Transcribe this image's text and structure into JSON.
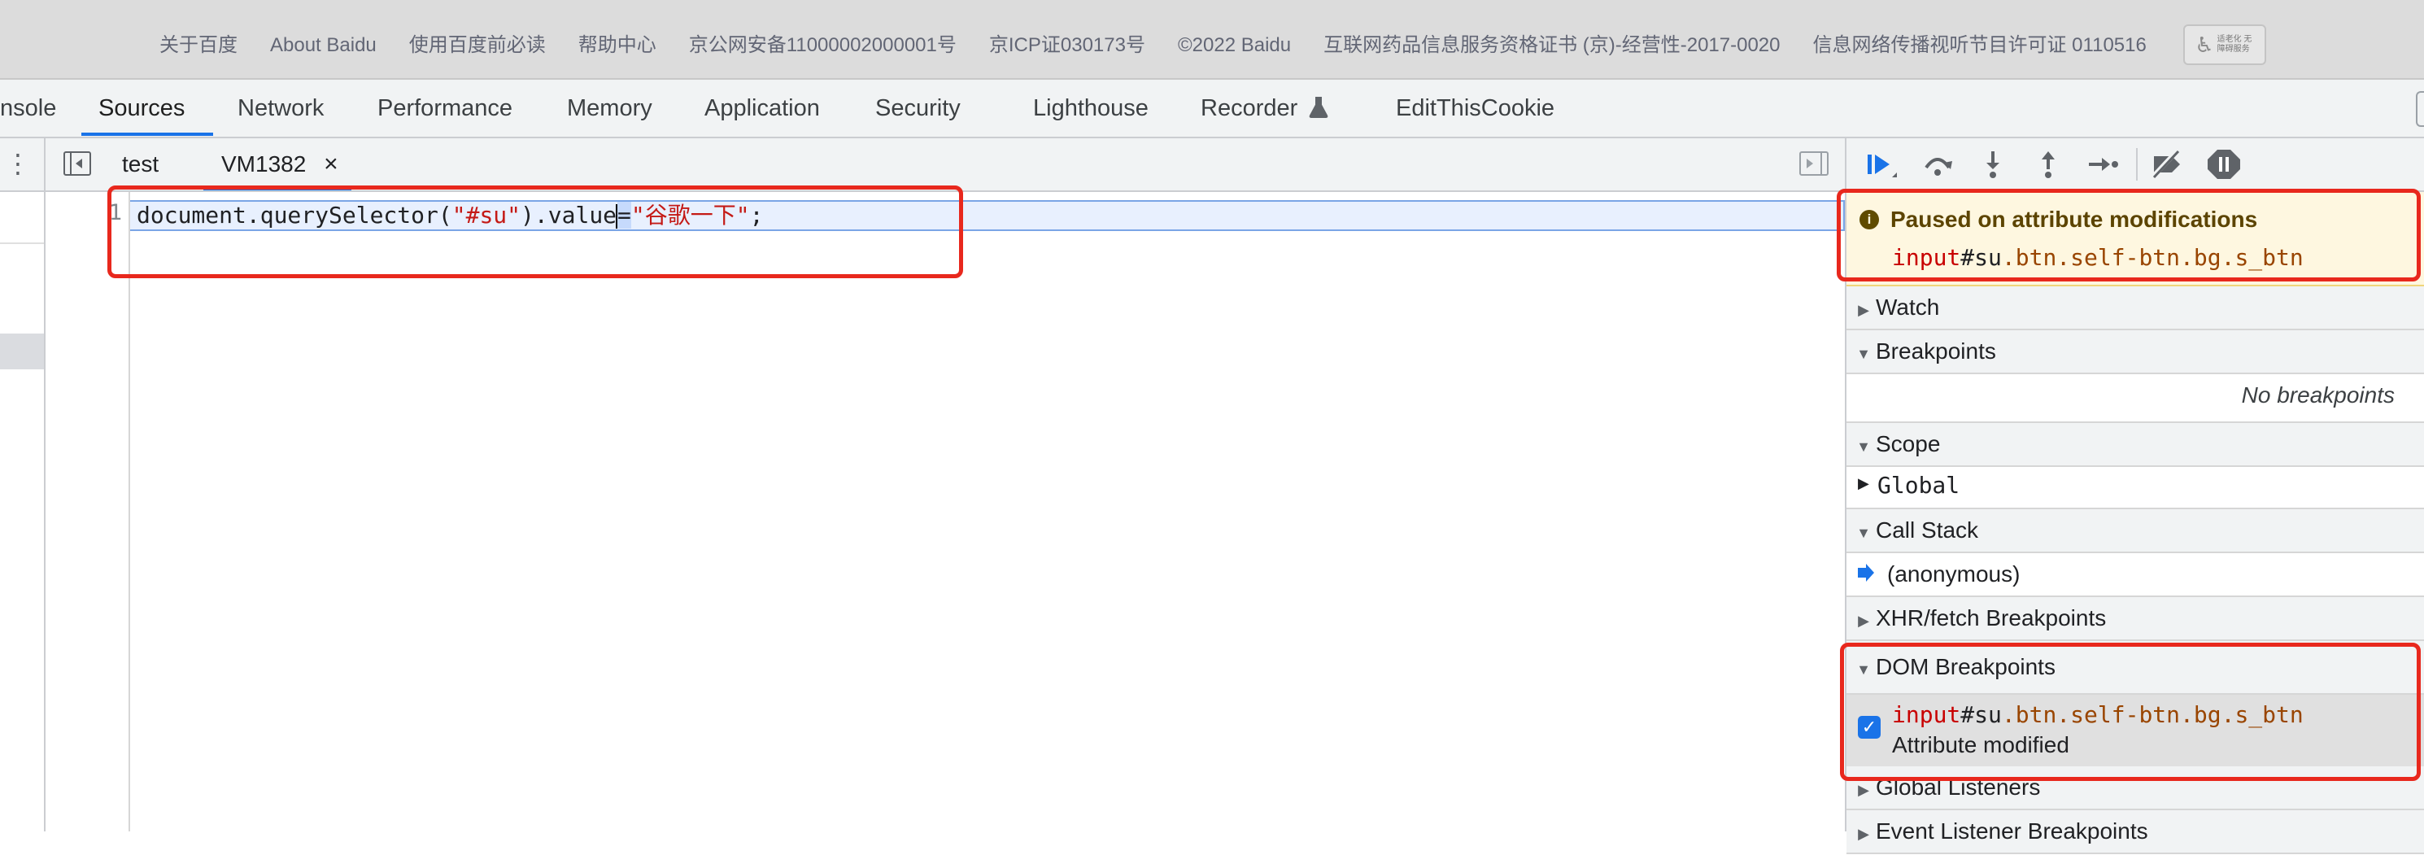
{
  "baidu_footer": {
    "links": [
      "关于百度",
      "About Baidu",
      "使用百度前必读",
      "帮助中心",
      "京公网安备11000002000001号",
      "京ICP证030173号",
      "©2022 Baidu",
      "互联网药品信息服务资格证书 (京)-经营性-2017-0020",
      "信息网络传播视听节目许可证 0110516"
    ],
    "badge": "适老化 无障碍服务"
  },
  "devtools_tabs": {
    "console": "nsole",
    "sources": "Sources",
    "network": "Network",
    "performance": "Performance",
    "memory": "Memory",
    "application": "Application",
    "security": "Security",
    "lighthouse": "Lighthouse",
    "recorder": "Recorder",
    "recorder_icon": "flask-icon",
    "editthiscookie": "EditThisCookie"
  },
  "editor_tabs": {
    "file1": "test",
    "file2": "VM1382",
    "close": "×"
  },
  "code": {
    "line_number": "1",
    "part1": "document.querySelector(",
    "part2": "\"#su\"",
    "part3": ").value",
    "part4": "=",
    "part5": "\"谷歌一下\"",
    "part6": ";"
  },
  "debugger": {
    "paused_title": "Paused on attribute modifications",
    "paused_tag": "input",
    "paused_id": "#su",
    "paused_classes": ".btn.self-btn.bg.s_btn",
    "sections": {
      "watch": "Watch",
      "breakpoints": "Breakpoints",
      "no_breakpoints": "No breakpoints",
      "scope": "Scope",
      "global": "Global",
      "call_stack": "Call Stack",
      "anonymous": "(anonymous)",
      "xhr": "XHR/fetch Breakpoints",
      "dom": "DOM Breakpoints",
      "global_listeners": "Global Listeners",
      "event_listener": "Event Listener Breakpoints"
    },
    "dom_bp": {
      "tag": "input",
      "id": "#su",
      "classes": ".btn.self-btn.bg.s_btn",
      "desc": "Attribute modified"
    }
  },
  "colors": {
    "accent": "#1a73e8",
    "highlight_red": "#e8281d",
    "paused_bg": "#fef7e0"
  }
}
